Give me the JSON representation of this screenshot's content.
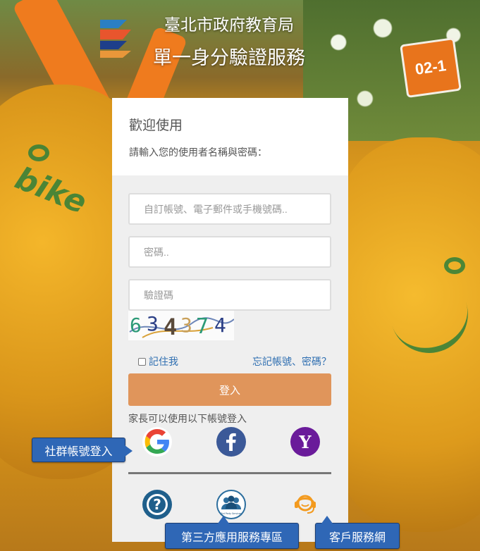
{
  "background": {
    "plate_text": "02-1",
    "bike_text": "bike"
  },
  "header": {
    "title": "臺北市政府教育局",
    "subtitle": "單一身分驗證服務"
  },
  "card": {
    "welcome": "歡迎使用",
    "hint": "請輸入您的使用者名稱與密碼：",
    "username_placeholder": "自訂帳號、電子郵件或手機號碼..",
    "password_placeholder": "密碼..",
    "captcha_placeholder": "驗證碼",
    "captcha_text": "634374",
    "remember_label": "記住我",
    "forgot_label": "忘記帳號、密碼？",
    "login_label": "登入",
    "parent_note": "家長可以使用以下帳號登入"
  },
  "social": [
    {
      "name": "Google",
      "icon": "google-icon"
    },
    {
      "name": "Facebook",
      "icon": "facebook-icon"
    },
    {
      "name": "Yahoo",
      "icon": "yahoo-icon"
    }
  ],
  "services": [
    {
      "icon": "help-icon"
    },
    {
      "icon": "third-party-icon",
      "label": "3rd Party Services"
    },
    {
      "icon": "customer-service-icon"
    }
  ],
  "callouts": {
    "social_login": "社群帳號登入",
    "third_party": "第三方應用服務專區",
    "customer_service": "客戶服務網"
  },
  "colors": {
    "login_button": "#e0955b",
    "link": "#2f6fb1",
    "callout": "#2f67b6",
    "facebook": "#3b5998",
    "yahoo": "#6a1b9a",
    "help": "#1f5f8b"
  }
}
